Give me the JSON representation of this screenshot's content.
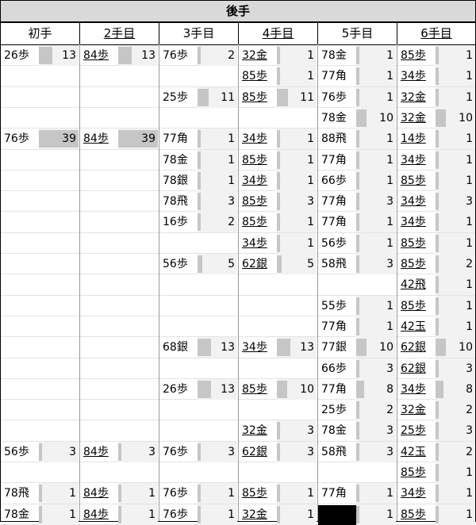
{
  "title": "後手",
  "headers": [
    "初手",
    "2手目",
    "3手目",
    "4手目",
    "5手目",
    "6手目"
  ],
  "rows": [
    [
      "26歩",
      "13",
      "84歩",
      "13",
      "76歩",
      "2",
      "32金",
      "1",
      "78金",
      "1",
      "85歩",
      "1"
    ],
    [
      "",
      "",
      "",
      "",
      "",
      "",
      "85歩",
      "1",
      "77角",
      "1",
      "34歩",
      "1"
    ],
    [
      "",
      "",
      "",
      "",
      "25歩",
      "11",
      "85歩",
      "11",
      "76歩",
      "1",
      "32金",
      "1"
    ],
    [
      "",
      "",
      "",
      "",
      "",
      "",
      "",
      "",
      "78金",
      "10",
      "32金",
      "10"
    ],
    [
      "76歩",
      "39",
      "84歩",
      "39",
      "77角",
      "1",
      "34歩",
      "1",
      "88飛",
      "1",
      "14歩",
      "1"
    ],
    [
      "",
      "",
      "",
      "",
      "78金",
      "1",
      "85歩",
      "1",
      "77角",
      "1",
      "34歩",
      "1"
    ],
    [
      "",
      "",
      "",
      "",
      "78銀",
      "1",
      "34歩",
      "1",
      "66歩",
      "1",
      "85歩",
      "1"
    ],
    [
      "",
      "",
      "",
      "",
      "78飛",
      "3",
      "85歩",
      "3",
      "77角",
      "3",
      "34歩",
      "3"
    ],
    [
      "",
      "",
      "",
      "",
      "16歩",
      "2",
      "85歩",
      "1",
      "77角",
      "1",
      "34歩",
      "1"
    ],
    [
      "",
      "",
      "",
      "",
      "",
      "",
      "34歩",
      "1",
      "56歩",
      "1",
      "85歩",
      "1"
    ],
    [
      "",
      "",
      "",
      "",
      "56歩",
      "5",
      "62銀",
      "5",
      "58飛",
      "3",
      "85歩",
      "2"
    ],
    [
      "",
      "",
      "",
      "",
      "",
      "",
      "",
      "",
      "",
      "",
      "42飛",
      "1"
    ],
    [
      "",
      "",
      "",
      "",
      "",
      "",
      "",
      "",
      "55歩",
      "1",
      "85歩",
      "1"
    ],
    [
      "",
      "",
      "",
      "",
      "",
      "",
      "",
      "",
      "77角",
      "1",
      "42玉",
      "1"
    ],
    [
      "",
      "",
      "",
      "",
      "68銀",
      "13",
      "34歩",
      "13",
      "77銀",
      "10",
      "62銀",
      "10"
    ],
    [
      "",
      "",
      "",
      "",
      "",
      "",
      "",
      "",
      "66歩",
      "3",
      "62銀",
      "3"
    ],
    [
      "",
      "",
      "",
      "",
      "26歩",
      "13",
      "85歩",
      "10",
      "77角",
      "8",
      "34歩",
      "8"
    ],
    [
      "",
      "",
      "",
      "",
      "",
      "",
      "",
      "",
      "25歩",
      "2",
      "32金",
      "2"
    ],
    [
      "",
      "",
      "",
      "",
      "",
      "",
      "32金",
      "3",
      "78金",
      "3",
      "25歩",
      "3"
    ],
    [
      "56歩",
      "3",
      "84歩",
      "3",
      "76歩",
      "3",
      "62銀",
      "3",
      "58飛",
      "3",
      "42玉",
      "2"
    ],
    [
      "",
      "",
      "",
      "",
      "",
      "",
      "",
      "",
      "",
      "",
      "85歩",
      "1"
    ],
    [
      "78飛",
      "1",
      "84歩",
      "1",
      "76歩",
      "1",
      "85歩",
      "1",
      "77角",
      "1",
      "34歩",
      "1"
    ],
    [
      "78金",
      "1",
      "84歩",
      "1",
      "76歩",
      "1",
      "32金",
      "1",
      "",
      "1",
      "85歩",
      "1"
    ]
  ],
  "colors": {
    "header_bg": "#d9d9d9",
    "count_bg": "#f2f2f2",
    "bar": "#c6c6c6",
    "blank_cell": "#000000"
  }
}
